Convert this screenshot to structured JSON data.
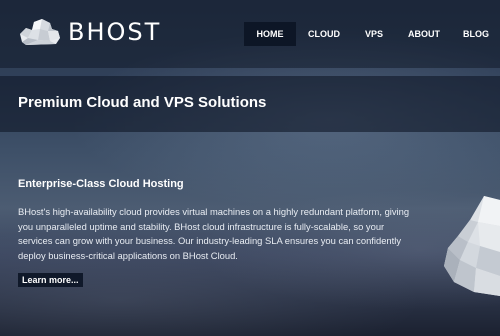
{
  "brand": {
    "name": "BHOST",
    "logo_icon": "cloud-logo-icon"
  },
  "nav": {
    "items": [
      {
        "label": "HOME",
        "active": true
      },
      {
        "label": "CLOUD",
        "active": false
      },
      {
        "label": "VPS",
        "active": false
      },
      {
        "label": "ABOUT",
        "active": false
      },
      {
        "label": "BLOG",
        "active": false
      }
    ]
  },
  "banner": {
    "title": "Premium Cloud and VPS Solutions"
  },
  "section": {
    "heading": "Enterprise-Class Cloud Hosting",
    "body": "BHost's high-availability cloud provides virtual machines on a highly redundant platform, giving you unparalleled uptime and stability. BHost cloud infrastructure is fully-scalable, so your services can grow with your business. Our industry-leading SLA ensures you can confidently deploy business-critical applications on BHost Cloud.",
    "cta_label": "Learn more..."
  },
  "colors": {
    "nav_active_bg": "#0d1626",
    "banner_bg": "#101828",
    "text": "#ffffff"
  }
}
